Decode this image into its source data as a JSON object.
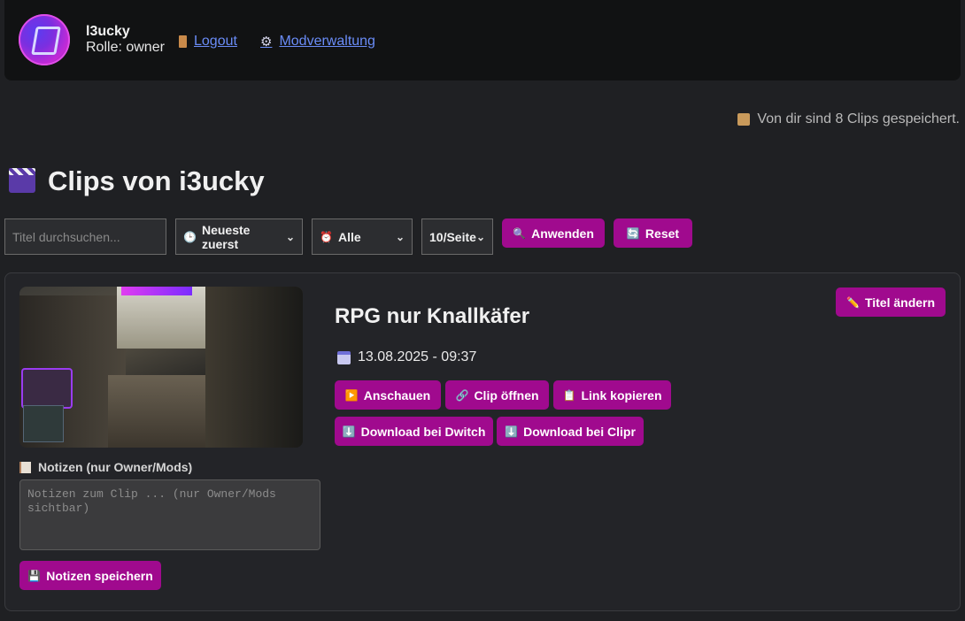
{
  "header": {
    "username": "l3ucky",
    "role": "Rolle: owner",
    "logout_label": "Logout",
    "modverwaltung_label": "Modverwaltung"
  },
  "saved_info": "Von dir sind 8 Clips gespeichert.",
  "page_title": "Clips von i3ucky",
  "filters": {
    "search_placeholder": "Titel durchsuchen...",
    "sort_value": "Neueste zuerst",
    "type_value": "Alle",
    "per_page_value": "10/Seite",
    "apply_label": "Anwenden",
    "reset_label": "Reset"
  },
  "clip": {
    "title": "RPG nur Knallkäfer",
    "date": "13.08.2025 - 09:37",
    "rename_label": "Titel ändern",
    "actions": {
      "watch": "Anschauen",
      "open": "Clip öffnen",
      "copy": "Link kopieren",
      "dl_dwitch": "Download bei Dwitch",
      "dl_clipr": "Download bei Clipr"
    },
    "notes_label": "Notizen (nur Owner/Mods)",
    "notes_placeholder": "Notizen zum Clip ... (nur Owner/Mods sichtbar)",
    "save_notes_label": "Notizen speichern"
  },
  "colors": {
    "accent": "#a00a8e",
    "link": "#6a8cf7",
    "background": "#1f2023"
  }
}
